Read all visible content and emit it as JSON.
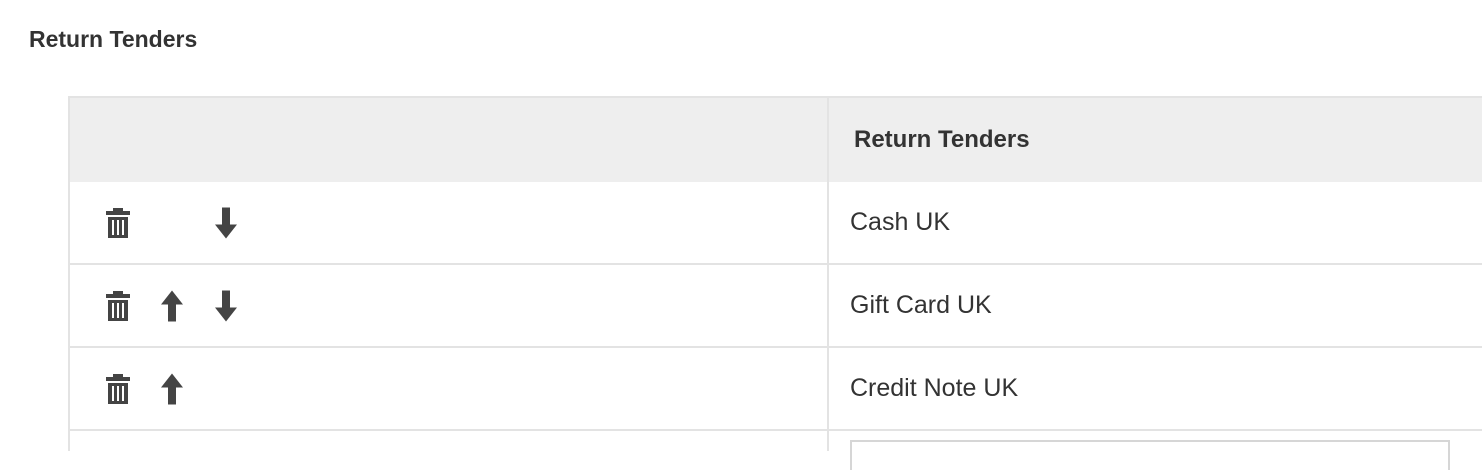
{
  "section": {
    "title": "Return Tenders"
  },
  "table": {
    "header": {
      "actions_label": "",
      "name_label": "Return Tenders"
    },
    "rows": [
      {
        "name": "Cash UK",
        "can_delete": true,
        "can_move_up": false,
        "can_move_down": true
      },
      {
        "name": "Gift Card UK",
        "can_delete": true,
        "can_move_up": true,
        "can_move_down": true
      },
      {
        "name": "Credit Note UK",
        "can_delete": true,
        "can_move_up": true,
        "can_move_down": false
      }
    ]
  },
  "icons": {
    "delete": "trash-icon",
    "move_up": "arrow-up-icon",
    "move_down": "arrow-down-icon"
  },
  "colors": {
    "header_bg": "#eeeeee",
    "border": "#e3e3e3",
    "icon": "#444444",
    "text": "#333333"
  }
}
